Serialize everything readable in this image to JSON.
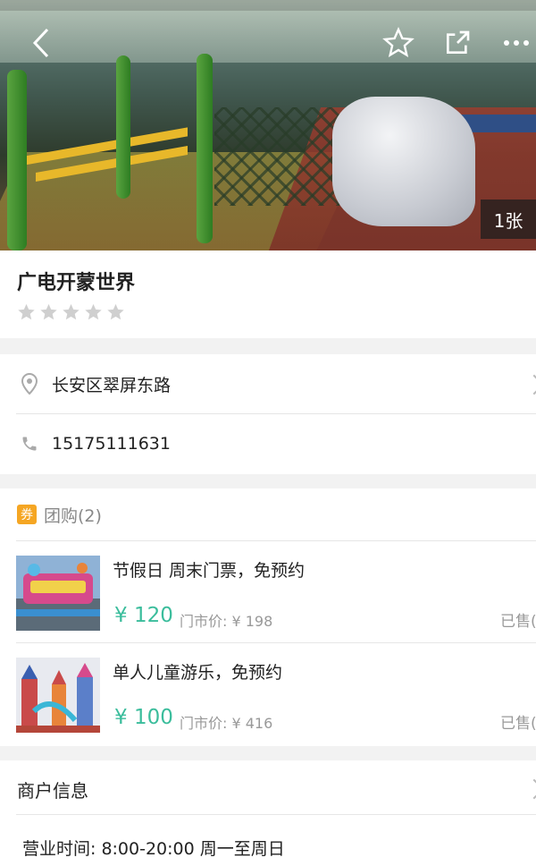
{
  "hero": {
    "photo_count": "1张"
  },
  "place": {
    "name": "广电开蒙世界",
    "rating_stars": 0
  },
  "info": {
    "address": "长安区翠屏东路",
    "phone": "15175111631"
  },
  "group_buy": {
    "badge": "券",
    "title": "团购(2)",
    "deals": [
      {
        "name": "节假日 周末门票，免预约",
        "price": "¥ 120",
        "original": "门市价: ¥ 198",
        "sold": "已售("
      },
      {
        "name": "单人儿童游乐，免预约",
        "price": "¥ 100",
        "original": "门市价: ¥ 416",
        "sold": "已售("
      }
    ]
  },
  "merchant": {
    "title": "商户信息",
    "hours": "营业时间:  8:00-20:00 周一至周日"
  },
  "colors": {
    "price": "#3bbd9c",
    "coupon_badge": "#f5a623"
  }
}
